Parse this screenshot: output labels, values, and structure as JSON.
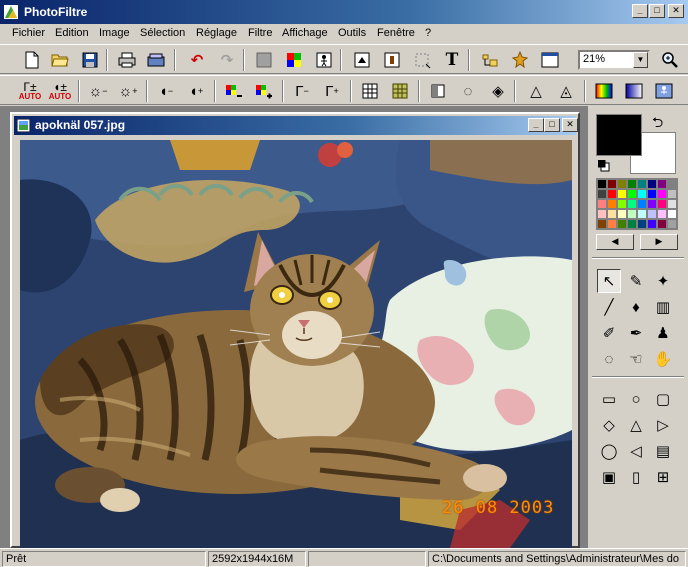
{
  "app": {
    "title": "PhotoFiltre"
  },
  "menu": [
    "Fichier",
    "Edition",
    "Image",
    "Sélection",
    "Réglage",
    "Filtre",
    "Affichage",
    "Outils",
    "Fenêtre",
    "?"
  ],
  "toolbar": {
    "zoom_value": "21%",
    "auto_label": "AUTO",
    "text_tool_glyph": "T"
  },
  "icons": {
    "toolbar1": [
      "new-icon",
      "open-icon",
      "save-icon",
      "print-icon",
      "scan-icon",
      "undo-icon",
      "redo-icon",
      "fill-gray-icon",
      "color-palette-icon",
      "flip-figure-icon",
      "image-size-icon",
      "canvas-size-icon",
      "crop-selection-icon",
      "text-icon",
      "explorer-icon",
      "plugin-icon",
      "window-icon",
      "zoom-icon"
    ],
    "toolbar2": [
      "brightness-auto-icon",
      "contrast-auto-icon",
      "brightness-minus-icon",
      "brightness-plus-icon",
      "contrast-minus-icon",
      "contrast-plus-icon",
      "saturation-minus-icon",
      "saturation-plus-icon",
      "gamma-minus-icon",
      "gamma-plus-icon",
      "grid-icon",
      "grid-color-icon",
      "soften-icon",
      "drop-icon",
      "drop-double-icon",
      "sharpen-icon",
      "sharpen-double-icon",
      "gradient-icon",
      "color-fade-icon",
      "animated-icon"
    ]
  },
  "document": {
    "title": "apoknäl 057.jpg",
    "photo_date": "26 08 2003"
  },
  "colors": {
    "foreground": "#000000",
    "background": "#ffffff",
    "palette": [
      "#000000",
      "#800000",
      "#808000",
      "#008000",
      "#008080",
      "#000080",
      "#800080",
      "#808080",
      "#404040",
      "#ff0000",
      "#ffff00",
      "#00ff00",
      "#00ffff",
      "#0000ff",
      "#ff00ff",
      "#c0c0c0",
      "#ff8080",
      "#ff8000",
      "#80ff00",
      "#00ff80",
      "#0080ff",
      "#8000ff",
      "#ff0080",
      "#e0e0e0",
      "#ffc0c0",
      "#ffe0a0",
      "#ffffc0",
      "#c0ffc0",
      "#c0ffff",
      "#c0c0ff",
      "#ffc0ff",
      "#ffffff",
      "#804000",
      "#ff8040",
      "#408000",
      "#008040",
      "#004080",
      "#4000ff",
      "#800040",
      "#a0a0a0"
    ]
  },
  "tools": [
    {
      "name": "select-arrow-icon",
      "glyph": "↖"
    },
    {
      "name": "eyedropper-icon",
      "glyph": "✎"
    },
    {
      "name": "magic-wand-icon",
      "glyph": "✦"
    },
    {
      "name": "line-icon",
      "glyph": "╱"
    },
    {
      "name": "fill-bucket-icon",
      "glyph": "♦"
    },
    {
      "name": "spray-icon",
      "glyph": "▥"
    },
    {
      "name": "brush-icon",
      "glyph": "✐"
    },
    {
      "name": "advanced-brush-icon",
      "glyph": "✒"
    },
    {
      "name": "stamp-icon",
      "glyph": "♟"
    },
    {
      "name": "blur-drop-icon",
      "glyph": "◌"
    },
    {
      "name": "smudge-icon",
      "glyph": "☜"
    },
    {
      "name": "hand-icon",
      "glyph": "✋"
    },
    {
      "name": "rectangle-icon",
      "glyph": "▭"
    },
    {
      "name": "ellipse-icon",
      "glyph": "○"
    },
    {
      "name": "rounded-rect-icon",
      "glyph": "▢"
    },
    {
      "name": "diamond-icon",
      "glyph": "◇"
    },
    {
      "name": "triangle-icon",
      "glyph": "△"
    },
    {
      "name": "triangle-right-icon",
      "glyph": "▷"
    },
    {
      "name": "lasso-icon",
      "glyph": "◯"
    },
    {
      "name": "polygon-icon",
      "glyph": "◁"
    },
    {
      "name": "open-folder-icon",
      "glyph": "▤"
    },
    {
      "name": "align-center-icon",
      "glyph": "▣"
    },
    {
      "name": "align-vertical-icon",
      "glyph": "▯"
    },
    {
      "name": "ratio-icon",
      "glyph": "⊞"
    }
  ],
  "status": {
    "state": "Prêt",
    "dimensions": "2592x1944x16M",
    "empty": "",
    "path": "C:\\Documents and Settings\\Administrateur\\Mes do"
  }
}
